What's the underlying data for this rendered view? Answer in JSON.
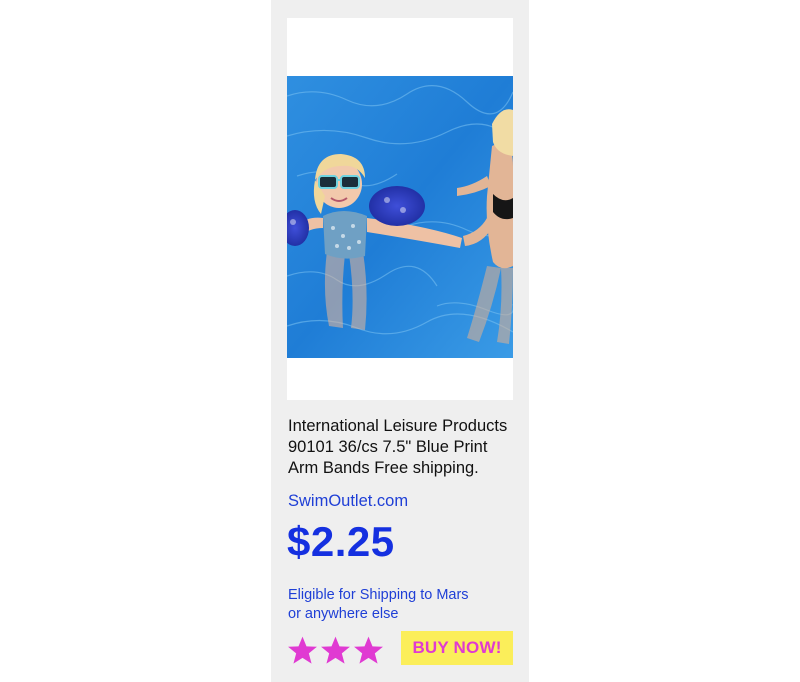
{
  "product": {
    "title_line1": "International Leisure Products",
    "title_line2": "90101 36/cs 7.5\" Blue Print",
    "title_line3": "Arm Bands Free shipping.",
    "seller": "SwimOutlet.com",
    "price": "$2.25",
    "shipping_line1": "Eligible for Shipping to Mars",
    "shipping_line2": "or anywhere else",
    "rating_stars": 3,
    "buy_label": "BUY NOW!",
    "image_icon": "product-photo-child-in-pool-with-arm-bands"
  },
  "colors": {
    "card_background": "#efefef",
    "link_blue": "#1f3fd6",
    "price_blue": "#1530e0",
    "star_magenta": "#e03ad2",
    "button_yellow": "#fbee5a",
    "button_text": "#e03ad2"
  }
}
